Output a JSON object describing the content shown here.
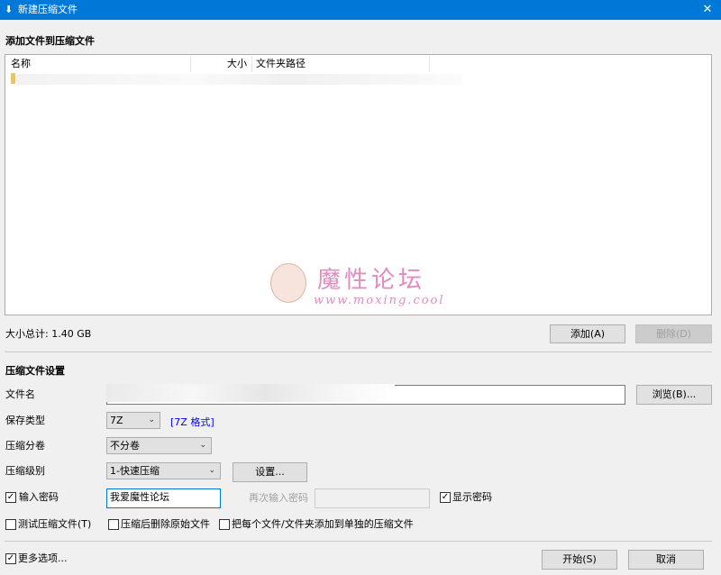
{
  "window": {
    "title": "新建压缩文件",
    "close_label": "✕"
  },
  "file_section": {
    "heading": "添加文件到压缩文件",
    "columns": [
      "名称",
      "大小",
      "文件夹路径"
    ],
    "total_size_label": "大小总计: 1.40 GB",
    "add_button": "添加(A)",
    "delete_button": "删除(D)"
  },
  "watermark": {
    "title": "魔性论坛",
    "url": "www.moxing.cool"
  },
  "settings": {
    "heading": "压缩文件设置",
    "filename_label": "文件名",
    "browse_button": "浏览(B)...",
    "save_type_label": "保存类型",
    "save_type_value": "7Z",
    "format_link": "[7Z 格式]",
    "split_label": "压缩分卷",
    "split_value": "不分卷",
    "level_label": "压缩级别",
    "level_value": "1-快速压缩",
    "settings_button": "设置...",
    "password_label": "输入密码",
    "password_value": "我爱魔性论坛",
    "reenter_label": "再次输入密码",
    "show_password_label": "显示密码",
    "test_label": "测试压缩文件(T)",
    "delete_after_label": "压缩后删除原始文件",
    "separate_label": "把每个文件/文件夹添加到单独的压缩文件"
  },
  "footer": {
    "more_options_label": "更多选项...",
    "start_button": "开始(S)",
    "cancel_button": "取消"
  },
  "checks": {
    "password": true,
    "show_password": true,
    "test": false,
    "delete_after": false,
    "separate": false,
    "more_options": true
  },
  "colors": {
    "titlebar": "#0078d7",
    "link": "#0000ff",
    "watermark": "#e38ac1"
  }
}
